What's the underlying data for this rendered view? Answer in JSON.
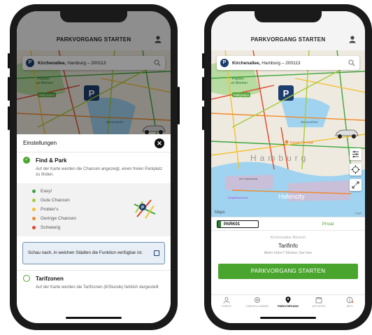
{
  "left": {
    "header_title": "PARKVORGANG STARTEN",
    "search_prefix": "Kirchenallee,",
    "search_rest": " Hamburg – 200113",
    "map_labels": {
      "plant": "Planten\nun Blomen",
      "wall": "Wallgraben",
      "binnen": "Binnenalster"
    },
    "sheet_title": "Einstellungen",
    "close_symbol": "✕",
    "options": [
      {
        "title": "Find & Park",
        "desc": "Auf der Karte werden die Chancen angezeigt, einen freien Parkplatz zu finden.",
        "checked": true
      },
      {
        "title": "Tarifzonen",
        "desc": "Auf der Karte werden die Tarifzonen (€/Stunde) farblich dargestellt",
        "checked": false
      }
    ],
    "legend": [
      {
        "label": "Easy!",
        "color": "#3aa63a"
      },
      {
        "label": "Gute Chancen",
        "color": "#a5cc3a"
      },
      {
        "label": "Probier's",
        "color": "#f2c230"
      },
      {
        "label": "Geringe Chancen",
        "color": "#f08a2a"
      },
      {
        "label": "Schwierig",
        "color": "#e0452b"
      }
    ],
    "info_text": "Schau nach, in welchen Städten die Funktion verfügbar ist."
  },
  "right": {
    "header_title": "PARKVORGANG STARTEN",
    "search_prefix": "Kirchenallee,",
    "search_rest": " Hamburg – 200113",
    "map_labels": {
      "plant": "Planten\nun Blomen",
      "wall": "Wallgraben",
      "binnen": "Binnenalster",
      "hamburg": "Hamburg",
      "europa": "Europa Passage",
      "hafencity": "Hafencity",
      "elbphil": "Elbphilharmonie",
      "amsand": "Am Sandtorkai"
    },
    "maps_brand": "Maps",
    "legal": "Legal",
    "plate": "PARK01",
    "private_tab": "Privat",
    "area_label": "Kirchenallee Bereich",
    "tarif_title": "Tarifinfo",
    "tarif_more": "Mehr Infos? Klicken Sie hier",
    "start_button": "PARKVORGANG STARTEN",
    "nav": [
      {
        "label": "KONTO",
        "icon": "user-icon",
        "active": false
      },
      {
        "label": "EINSTELLUNGEN",
        "icon": "gear-icon",
        "active": false
      },
      {
        "label": "PARKVORGANG",
        "icon": "location-pin-icon",
        "active": true
      },
      {
        "label": "AKTIVITÄT",
        "icon": "folder-icon",
        "active": false
      },
      {
        "label": "INFO",
        "icon": "info-icon",
        "active": false
      }
    ]
  },
  "colors": {
    "green": "#4aa52e",
    "navy": "#1d3d6e",
    "water": "#9fd3f0",
    "park": "#b7dba0"
  }
}
